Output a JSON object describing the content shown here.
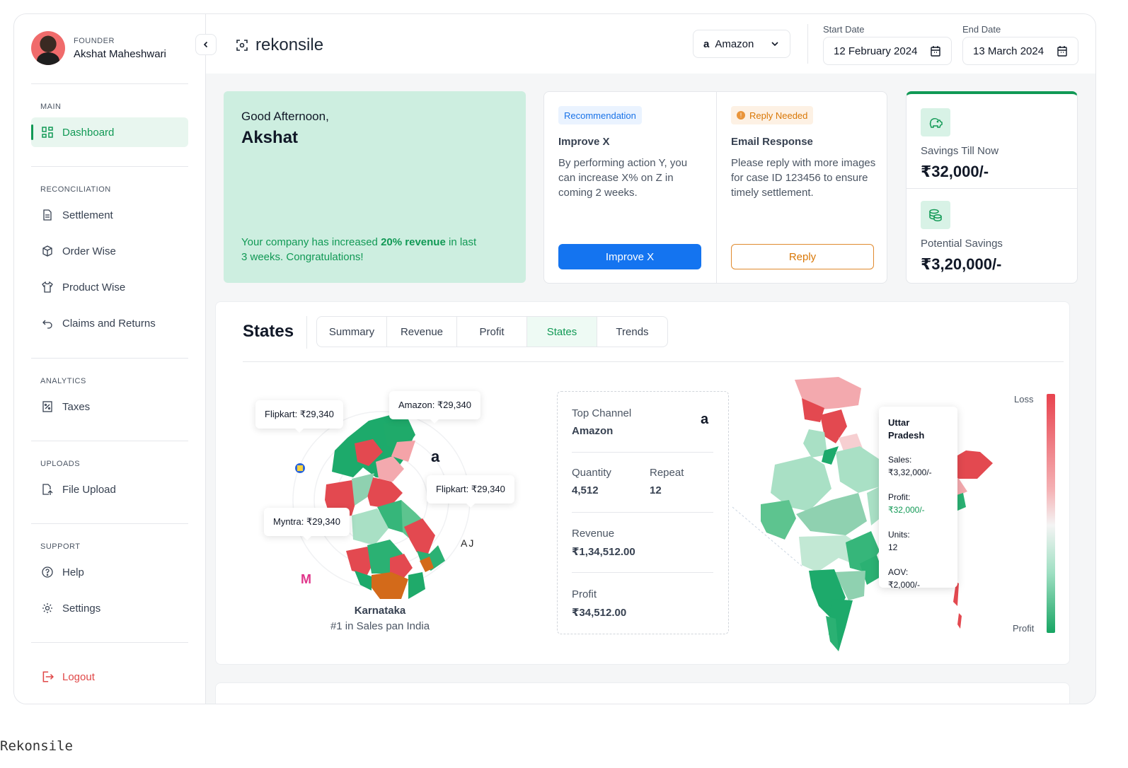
{
  "profile": {
    "role": "FOUNDER",
    "name": "Akshat Maheshwari"
  },
  "sidebar": {
    "main_label": "MAIN",
    "dashboard": "Dashboard",
    "recon_label": "RECONCILIATION",
    "settlement": "Settlement",
    "order_wise": "Order Wise",
    "product_wise": "Product Wise",
    "claims": "Claims and Returns",
    "analytics_label": "ANALYTICS",
    "taxes": "Taxes",
    "uploads_label": "UPLOADS",
    "file_upload": "File Upload",
    "support_label": "SUPPORT",
    "help": "Help",
    "settings": "Settings",
    "logout": "Logout"
  },
  "header": {
    "brand": "rekonsile",
    "channel": "Amazon",
    "start_label": "Start Date",
    "start_date": "12 February 2024",
    "end_label": "End Date",
    "end_date": "13 March 2024"
  },
  "greeting": {
    "hello": "Good Afternoon,",
    "name": "Akshat",
    "msg_pre": "Your company has increased ",
    "msg_bold": "20% revenue",
    "msg_post": " in last 3 weeks. Congratulations!"
  },
  "recommendation": {
    "tag": "Recommendation",
    "title": "Improve X",
    "body": "By performing action Y, you can increase X% on Z in coming 2 weeks.",
    "button": "Improve X"
  },
  "reply": {
    "tag": "Reply Needed",
    "title": "Email Response",
    "body": "Please reply with more images for case ID 123456 to ensure timely settlement.",
    "button": "Reply"
  },
  "savings": {
    "till_now_label": "Savings Till Now",
    "till_now_value": "₹32,000/-",
    "potential_label": "Potential Savings",
    "potential_value": "₹3,20,000/-"
  },
  "states": {
    "title": "States",
    "tabs": [
      "Summary",
      "Revenue",
      "Profit",
      "States",
      "Trends"
    ],
    "active_tab": "States",
    "callouts": {
      "flipkart_left": "Flipkart: ₹29,340",
      "amazon": "Amazon: ₹29,340",
      "flipkart_right": "Flipkart: ₹29,340",
      "myntra": "Myntra: ₹29,340",
      "ajio_logo": "AJIO"
    },
    "state_name": "Karnataka",
    "state_sub": "#1 in Sales pan India"
  },
  "stats": {
    "top_channel_label": "Top Channel",
    "top_channel_value": "Amazon",
    "quantity_label": "Quantity",
    "quantity_value": "4,512",
    "repeat_label": "Repeat",
    "repeat_value": "12",
    "revenue_label": "Revenue",
    "revenue_value": "₹1,34,512.00",
    "profit_label": "Profit",
    "profit_value": "₹34,512.00"
  },
  "tooltip": {
    "state": "Uttar Pradesh",
    "sales_label": "Sales:",
    "sales_value": "₹3,32,000/-",
    "profit_label": "Profit:",
    "profit_value": "₹32,000/-",
    "units_label": "Units:",
    "units_value": "12",
    "aov_label": "AOV:",
    "aov_value": "₹2,000/-"
  },
  "legend": {
    "top": "Loss",
    "bottom": "Profit"
  },
  "colors": {
    "accent": "#119955",
    "primary_button": "#1474f0",
    "warning": "#d97706",
    "loss": "#e8434e",
    "profit": "#17a563"
  },
  "caption": "Rekonsile"
}
